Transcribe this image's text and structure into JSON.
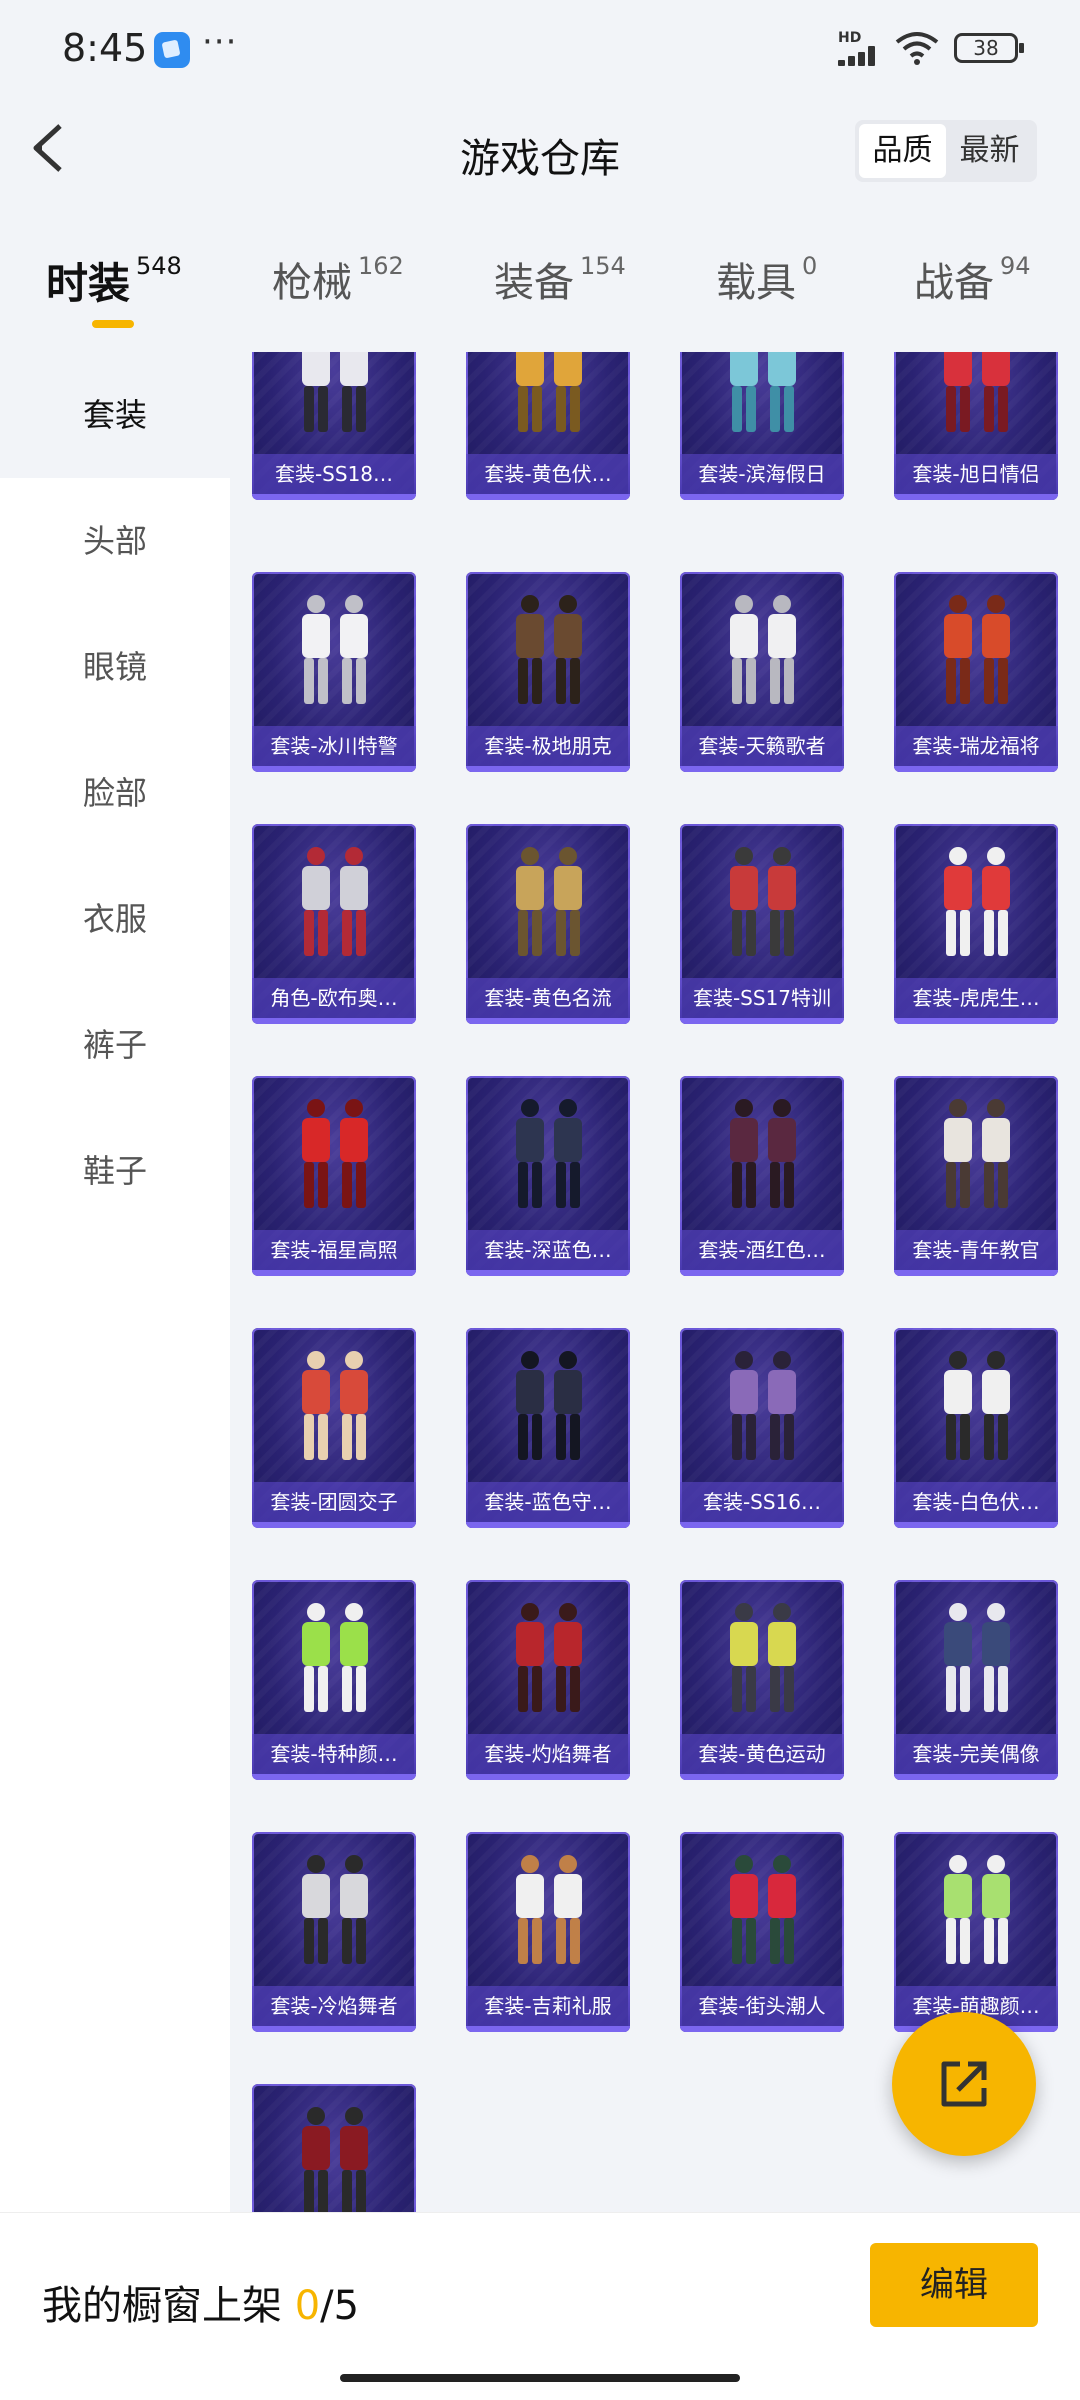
{
  "status": {
    "time": "8:45",
    "more": "···",
    "network": "HD",
    "battery": "38"
  },
  "header": {
    "title": "游戏仓库",
    "sort_quality": "品质",
    "sort_latest": "最新"
  },
  "tabs": [
    {
      "label": "时装",
      "count": "548"
    },
    {
      "label": "枪械",
      "count": "162"
    },
    {
      "label": "装备",
      "count": "154"
    },
    {
      "label": "载具",
      "count": "0"
    },
    {
      "label": "战备",
      "count": "94"
    }
  ],
  "sidebar": [
    "套装",
    "头部",
    "眼镜",
    "脸部",
    "衣服",
    "裤子",
    "鞋子"
  ],
  "items": [
    "套装-SS18…",
    "套装-黄色伏…",
    "套装-滨海假日",
    "套装-旭日情侣",
    "套装-冰川特警",
    "套装-极地朋克",
    "套装-天籁歌者",
    "套装-瑞龙福将",
    "角色-欧布奥…",
    "套装-黄色名流",
    "套装-SS17特训",
    "套装-虎虎生…",
    "套装-福星高照",
    "套装-深蓝色…",
    "套装-酒红色…",
    "套装-青年教官",
    "套装-团圆交子",
    "套装-蓝色守…",
    "套装-SS16…",
    "套装-白色伏…",
    "套装-特种颜…",
    "套装-灼焰舞者",
    "套装-黄色运动",
    "套装-完美偶像",
    "套装-冷焰舞者",
    "套装-吉莉礼服",
    "套装-街头潮人",
    "套装-萌趣颜…",
    ""
  ],
  "item_colors": [
    [
      "#e8e8ee",
      "#2a2a33"
    ],
    [
      "#e0a53a",
      "#7a5a20"
    ],
    [
      "#7cc7d8",
      "#3f8fa6"
    ],
    [
      "#d8313c",
      "#7a1a22"
    ],
    [
      "#f2f2f4",
      "#c0c0c8"
    ],
    [
      "#6a4a30",
      "#2c221a"
    ],
    [
      "#f0f0f2",
      "#b8b8c0"
    ],
    [
      "#d84b2a",
      "#7a2a18"
    ],
    [
      "#d0d0d8",
      "#b32a36"
    ],
    [
      "#c8a45a",
      "#6b5530"
    ],
    [
      "#c83a3a",
      "#3a3a3a"
    ],
    [
      "#e03a3a",
      "#f0f0f0"
    ],
    [
      "#d82828",
      "#7a1414"
    ],
    [
      "#2d3550",
      "#151a2c"
    ],
    [
      "#5a2840",
      "#2a1a22"
    ],
    [
      "#e8e4de",
      "#4a3a34"
    ],
    [
      "#d84a3a",
      "#e8d0b0"
    ],
    [
      "#2a2e44",
      "#141622"
    ],
    [
      "#8a6ab8",
      "#2a2238"
    ],
    [
      "#f0f0f0",
      "#2a2a2a"
    ],
    [
      "#9be04a",
      "#f0f0f0"
    ],
    [
      "#b8262c",
      "#3a1a1a"
    ],
    [
      "#d8d850",
      "#3a3a46"
    ],
    [
      "#3a4a7a",
      "#e8e8ee"
    ],
    [
      "#d8d8dc",
      "#2a2a2a"
    ],
    [
      "#f0f0f0",
      "#c08048"
    ],
    [
      "#d8283c",
      "#2a4a3a"
    ],
    [
      "#a8e070",
      "#f0f0f0"
    ],
    [
      "#8a1a22",
      "#2a2a2a"
    ]
  ],
  "bottom": {
    "showcase_prefix": "我的橱窗上架 ",
    "showcase_count": "0",
    "showcase_total": "/5",
    "edit_label": "编辑"
  }
}
